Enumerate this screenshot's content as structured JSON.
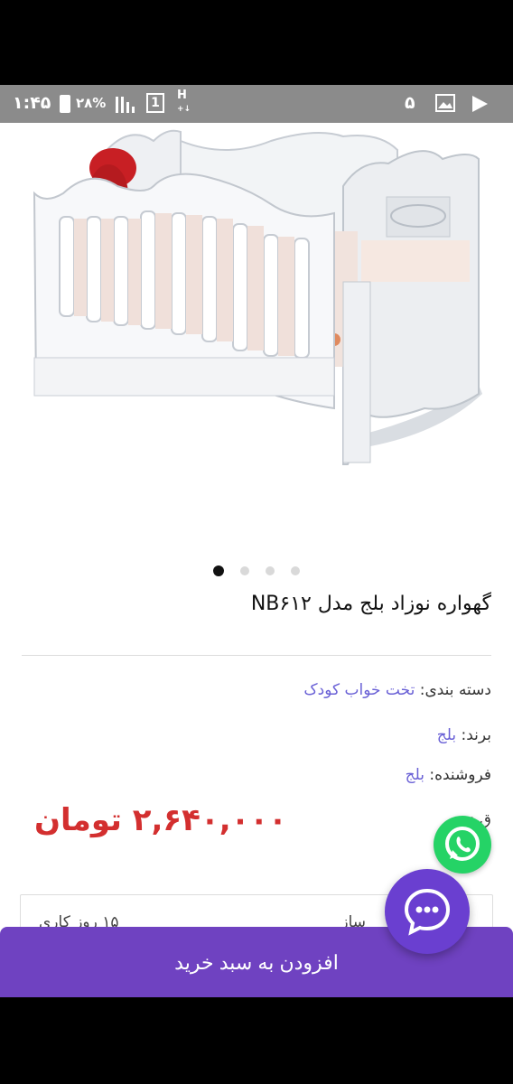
{
  "status_bar": {
    "time": "۱:۴۵",
    "battery": "۲۸%",
    "sim": "1",
    "network": "H",
    "network_sub": "+↓",
    "notification_count": "۵"
  },
  "product": {
    "title": "گهواره نوزاد بلج مدل NB۶۱۲",
    "category_label": "دسته بندی:",
    "category_value": "تخت خواب کودک",
    "brand_label": "برند:",
    "brand_value": "بلج",
    "seller_label": "فروشنده:",
    "seller_value": "بلج",
    "partial_label": "ق :",
    "price": "۲,۶۴۰,۰۰۰ تومان"
  },
  "carousel": {
    "total": 4,
    "active_index": 0
  },
  "info_box": {
    "delivery_partial": "۱۵ روز کاری",
    "right_partial": "ساز"
  },
  "actions": {
    "add_to_cart": "افزودن به سبد خرید"
  },
  "colors": {
    "accent": "#6f42c1",
    "price": "#d32f2f",
    "link": "#6a61d6",
    "whatsapp": "#25d366"
  }
}
